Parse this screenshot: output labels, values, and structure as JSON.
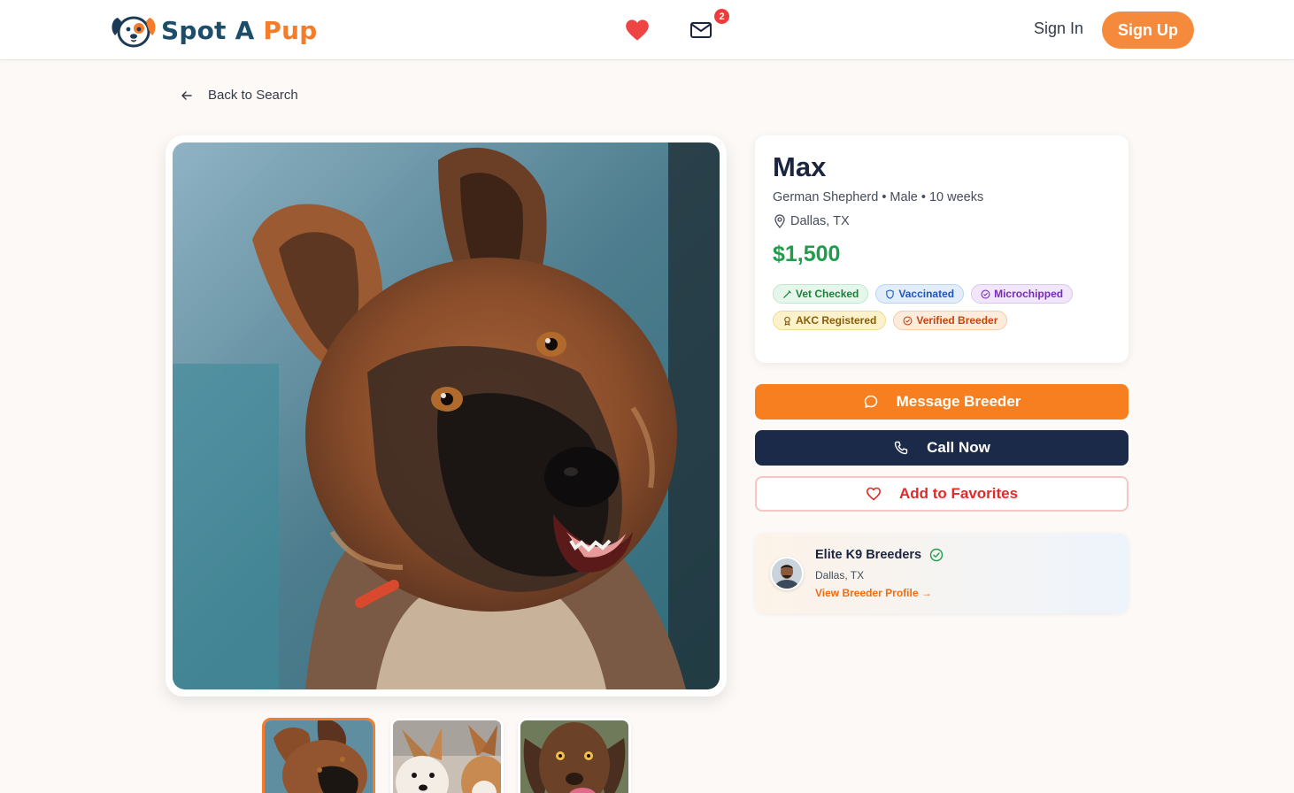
{
  "header": {
    "logo_word1": "Spot A",
    "logo_word2": "Pup",
    "mail_badge_count": "2",
    "sign_in": "Sign In",
    "sign_up": "Sign Up"
  },
  "nav": {
    "back_label": "Back to Search"
  },
  "listing": {
    "name": "Max",
    "breed": "German Shepherd",
    "sex": "Male",
    "age": "10 weeks",
    "meta_line": "German Shepherd • Male • 10 weeks",
    "location": "Dallas, TX",
    "price": "$1,500",
    "badges": [
      {
        "label": "Vet Checked",
        "icon": "stethoscope-icon",
        "color": "#1e7e3a"
      },
      {
        "label": "Vaccinated",
        "icon": "shield-icon",
        "color": "#1e56b8"
      },
      {
        "label": "Microchipped",
        "icon": "check-circle-icon",
        "color": "#7a2bb3"
      },
      {
        "label": "AKC Registered",
        "icon": "award-icon",
        "color": "#8a5d09"
      },
      {
        "label": "Verified Breeder",
        "icon": "check-circle-icon",
        "color": "#c2460f"
      }
    ]
  },
  "actions": {
    "message": "Message Breeder",
    "call": "Call Now",
    "favorite": "Add to Favorites"
  },
  "breeder": {
    "name": "Elite K9 Breeders",
    "location": "Dallas, TX",
    "profile_link": "View Breeder Profile →"
  },
  "gallery": {
    "thumbnails": [
      {
        "subject": "German Shepherd",
        "selected": true
      },
      {
        "subject": "Corgis",
        "selected": false
      },
      {
        "subject": "Brown Labrador",
        "selected": false
      }
    ]
  },
  "colors": {
    "brand_orange": "#f47c2b",
    "brand_navy": "#1c2a4a",
    "price_green": "#1f9d4b",
    "favorite_red": "#e22a2a"
  }
}
